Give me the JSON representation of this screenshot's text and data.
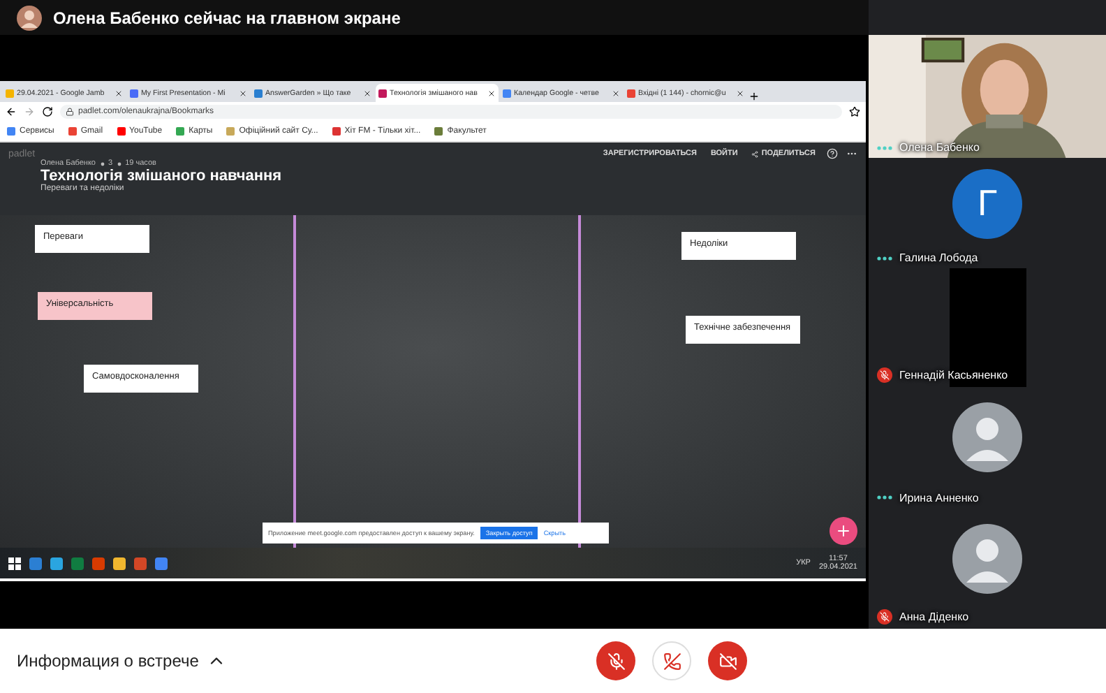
{
  "meet_header": {
    "presenter_notice": "Олена Бабенко сейчас на главном экране"
  },
  "shared_screen": {
    "browser_tabs": [
      {
        "title": "29.04.2021 - Google Jamb",
        "selected": false
      },
      {
        "title": "My First Presentation - Mi",
        "selected": false
      },
      {
        "title": "AnswerGarden » Що таке",
        "selected": false
      },
      {
        "title": "Технологія змішаного нав",
        "selected": true
      },
      {
        "title": "Календар Google - четве",
        "selected": false
      },
      {
        "title": "Вхідні (1 144) - chornic@u",
        "selected": false
      }
    ],
    "address": "padlet.com/olenaukrajna/Bookmarks",
    "bookmarks": [
      "Сервисы",
      "Gmail",
      "YouTube",
      "Карты",
      "Офіційний сайт Су...",
      "Хіт FM - Тільки хіт...",
      "Факультет"
    ],
    "padlet": {
      "logo": "padlet",
      "actions": [
        "ЗАРЕГИСТРИРОВАТЬСЯ",
        "ВОЙТИ",
        "ПОДЕЛИТЬСЯ"
      ],
      "author": "Олена Бабенко",
      "likes": "3",
      "age": "19 часов",
      "title": "Технологія змішаного навчання",
      "subtitle": "Переваги та недоліки",
      "cards": [
        {
          "text": "Переваги",
          "highlighted": false
        },
        {
          "text": "Універсальність",
          "highlighted": true
        },
        {
          "text": "Самовдосконалення",
          "highlighted": false
        },
        {
          "text": "Недоліки",
          "highlighted": false
        },
        {
          "text": "Технічне забезпечення",
          "highlighted": false
        }
      ]
    },
    "share_notice": {
      "message": "Приложение meet.google.com предоставлен доступ к вашему экрану.",
      "stop_button": "Закрыть доступ",
      "hide_link": "Скрыть"
    },
    "taskbar": {
      "language": "УКР",
      "time": "11:57",
      "date": "29.04.2021"
    }
  },
  "participants": [
    {
      "name": "Олена Бабенко",
      "kind": "video",
      "muted": false
    },
    {
      "name": "Галина Лобода",
      "kind": "letter",
      "initial": "Г",
      "muted": false
    },
    {
      "name": "Геннадій Касьяненко",
      "kind": "camera",
      "muted": true
    },
    {
      "name": "Ирина Анненко",
      "kind": "avatar",
      "muted": false
    },
    {
      "name": "Анна Діденко",
      "kind": "avatar",
      "muted": true
    }
  ],
  "footer": {
    "meeting_info": "Информация о встрече",
    "controls": [
      {
        "kind": "mic",
        "on": false
      },
      {
        "kind": "hangup"
      },
      {
        "kind": "camera",
        "on": false
      }
    ]
  }
}
